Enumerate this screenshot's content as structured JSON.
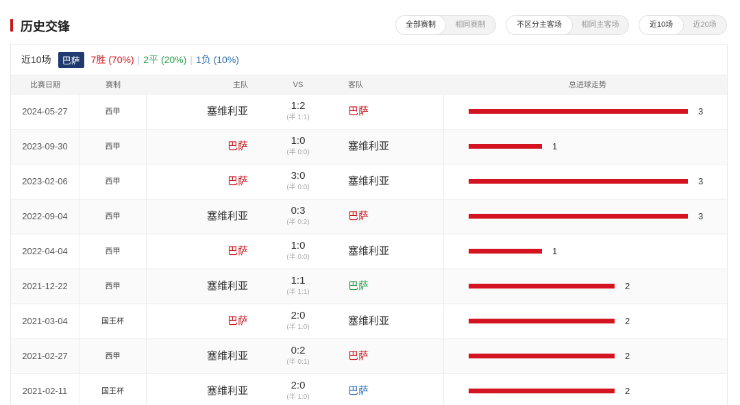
{
  "header": {
    "title": "历史交锋"
  },
  "filters": {
    "competition": {
      "options": [
        "全部赛制",
        "相同赛制"
      ],
      "active": 0
    },
    "venue": {
      "options": [
        "不区分主客场",
        "相同主客场"
      ],
      "active": 0
    },
    "range": {
      "options": [
        "近10场",
        "近20场"
      ],
      "active": 0
    }
  },
  "summary": {
    "recent_label": "近10场",
    "team": "巴萨",
    "win": "7胜 (70%)",
    "draw": "2平 (20%)",
    "loss": "1负 (10%)",
    "separator": "|",
    "colors": {
      "team_badge": "#1e3a6e",
      "win": "#c8161d",
      "draw": "#2a9a4a",
      "loss": "#2b6cb0"
    }
  },
  "table": {
    "columns": {
      "date": "比赛日期",
      "type": "赛制",
      "home": "主队",
      "vs": "VS",
      "away": "客队",
      "trend": "总进球走势"
    },
    "max_goals": 3,
    "rows": [
      {
        "date": "2024-05-27",
        "type": "西甲",
        "home": "塞维利亚",
        "home_color": "",
        "ft": "1:2",
        "ht": "(半 1:1)",
        "away": "巴萨",
        "away_color": "red",
        "total": 3
      },
      {
        "date": "2023-09-30",
        "type": "西甲",
        "home": "巴萨",
        "home_color": "red",
        "ft": "1:0",
        "ht": "(半 0:0)",
        "away": "塞维利亚",
        "away_color": "",
        "total": 1
      },
      {
        "date": "2023-02-06",
        "type": "西甲",
        "home": "巴萨",
        "home_color": "red",
        "ft": "3:0",
        "ht": "(半 0:0)",
        "away": "塞维利亚",
        "away_color": "",
        "total": 3
      },
      {
        "date": "2022-09-04",
        "type": "西甲",
        "home": "塞维利亚",
        "home_color": "",
        "ft": "0:3",
        "ht": "(半 0:2)",
        "away": "巴萨",
        "away_color": "red",
        "total": 3
      },
      {
        "date": "2022-04-04",
        "type": "西甲",
        "home": "巴萨",
        "home_color": "red",
        "ft": "1:0",
        "ht": "(半 0:0)",
        "away": "塞维利亚",
        "away_color": "",
        "total": 1
      },
      {
        "date": "2021-12-22",
        "type": "西甲",
        "home": "塞维利亚",
        "home_color": "",
        "ft": "1:1",
        "ht": "(半 1:1)",
        "away": "巴萨",
        "away_color": "green",
        "total": 2
      },
      {
        "date": "2021-03-04",
        "type": "国王杯",
        "home": "巴萨",
        "home_color": "red",
        "ft": "2:0",
        "ht": "(半 1:0)",
        "away": "塞维利亚",
        "away_color": "",
        "total": 2
      },
      {
        "date": "2021-02-27",
        "type": "西甲",
        "home": "塞维利亚",
        "home_color": "",
        "ft": "0:2",
        "ht": "(半 0:1)",
        "away": "巴萨",
        "away_color": "red",
        "total": 2
      },
      {
        "date": "2021-02-11",
        "type": "国王杯",
        "home": "塞维利亚",
        "home_color": "",
        "ft": "2:0",
        "ht": "(半 1:0)",
        "away": "巴萨",
        "away_color": "blue",
        "total": 2
      }
    ]
  }
}
